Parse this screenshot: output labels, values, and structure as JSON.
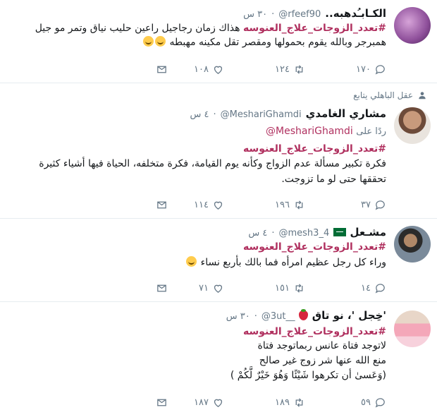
{
  "tweets": [
    {
      "name": "الكـابـُدهبه..",
      "handle": "@rfeef90",
      "time": "٣٠ س",
      "lines": [
        {
          "hashtag": "#تعدد_الزوجات_علاج_العنوسه",
          "text": " هذاك زمان رجاجيل راعين حليب نياق وتمر مو جيل"
        },
        {
          "text": "همبرجر وبالله يقوم بحمولها ومقصر تقل مكينه مهبطه"
        }
      ],
      "replies": "١٧٠",
      "retweets": "١٢٤",
      "likes": "١٠٨"
    },
    {
      "retweet_label": "عقل الباهلي يتابع",
      "name": "مشاري الغامدي",
      "handle": "@MeshariGhamdi",
      "time": "٤ س",
      "reply_to_prefix": "ردًا على",
      "reply_to_handle": "@MeshariGhamdi",
      "lines": [
        {
          "hashtag": "#تعدد_الزوجات_علاج_العنوسه",
          "text": ""
        },
        {
          "text": "فكرة تكبير مسألة عدم الزواج وكأنه يوم القيامة، فكرة متخلفه، الحياة فيها أشياء كثيرة"
        },
        {
          "text": "تحققها حتى لو ما تزوجت."
        }
      ],
      "replies": "٣٧",
      "retweets": "١٩٦",
      "likes": "١١٤"
    },
    {
      "name": "مشـعل",
      "handle": "@mesh3_4",
      "time": "٤ س",
      "lines": [
        {
          "hashtag": "#تعدد_الزوجات_علاج_العنوسه",
          "text": ""
        },
        {
          "text": "وراء كل رجل عظيم امرأه فما بالك بأربع نساء"
        }
      ],
      "replies": "١٤",
      "retweets": "١٥١",
      "likes": "٧١"
    },
    {
      "name": "'خِجل '، نو تاق",
      "handle": "@3ut__",
      "time": "٣٠ س",
      "lines": [
        {
          "hashtag": "#تعدد_الزوجات_علاج_العنوسه",
          "text": ""
        },
        {
          "text": "لاتوجد فتاة عانس ربماتوجد فتاة"
        },
        {
          "text": "منع الله عنها شر زوج غير صالح"
        },
        {
          "text": "(وَعَسىٰ أن تكرهوا شَيْئًا وَهُوَ خَيْرٌ لَّكُمْ )"
        }
      ],
      "replies": "٥٩",
      "retweets": "١٨٩",
      "likes": "١٨٧"
    }
  ],
  "colors": {
    "accent": "#b0305f",
    "muted": "#657786",
    "divider": "#e6ecf0"
  },
  "icons": [
    "reply-icon",
    "retweet-icon",
    "like-icon",
    "message-icon",
    "follow-person-icon",
    "saudi-flag-icon",
    "strawberry-icon",
    "smile-emoji-icon"
  ]
}
